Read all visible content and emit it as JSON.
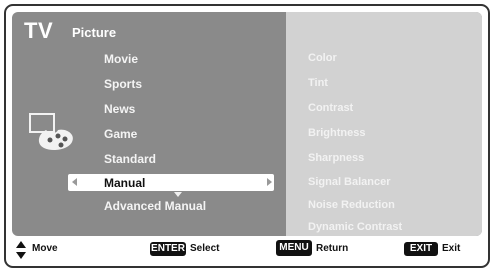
{
  "header": {
    "tv": "TV",
    "section": "Picture"
  },
  "menu": {
    "items": [
      "Movie",
      "Sports",
      "News",
      "Game",
      "Standard"
    ],
    "selected": "Manual",
    "after": "Advanced Manual"
  },
  "settings": [
    "Color",
    "Tint",
    "Contrast",
    "Brightness",
    "Sharpness",
    "Signal Balancer",
    "Noise Reduction",
    "Dynamic Contrast"
  ],
  "footer": {
    "move": "Move",
    "enter_key": "ENTER",
    "enter_label": "Select",
    "menu_key": "MENU",
    "menu_label": "Return",
    "exit_key": "EXIT",
    "exit_label": "Exit"
  },
  "icons": {
    "palette": "palette-icon",
    "updown": "up-down-arrow-icon"
  }
}
